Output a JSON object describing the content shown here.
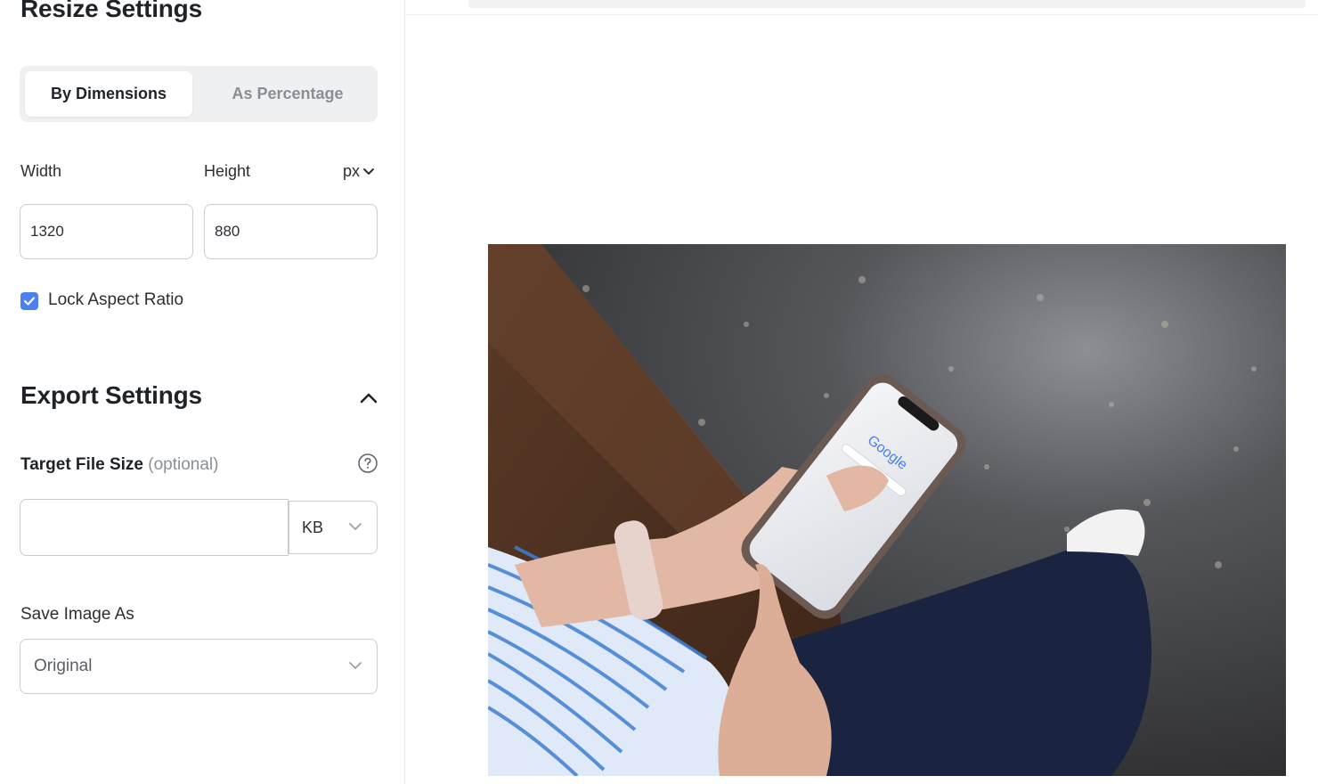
{
  "resize_settings": {
    "title": "Resize Settings",
    "tabs": [
      {
        "label": "By Dimensions",
        "active": true
      },
      {
        "label": "As Percentage",
        "active": false
      }
    ],
    "width_label": "Width",
    "height_label": "Height",
    "unit": "px",
    "width_value": "1320",
    "height_value": "880",
    "lock_aspect_label": "Lock Aspect Ratio",
    "lock_aspect_checked": true
  },
  "export_settings": {
    "title": "Export Settings",
    "target_size_label": "Target File Size",
    "target_size_optional": "(optional)",
    "target_size_value": "",
    "target_size_unit": "KB",
    "save_as_label": "Save Image As",
    "save_as_value": "Original"
  },
  "preview": {
    "image_alt": "Person holding smartphone showing Google search",
    "phone_screen_text": "Google"
  },
  "colors": {
    "accent": "#4c7ff0",
    "border": "#c9cdd2",
    "muted_text": "#8a8f96"
  }
}
